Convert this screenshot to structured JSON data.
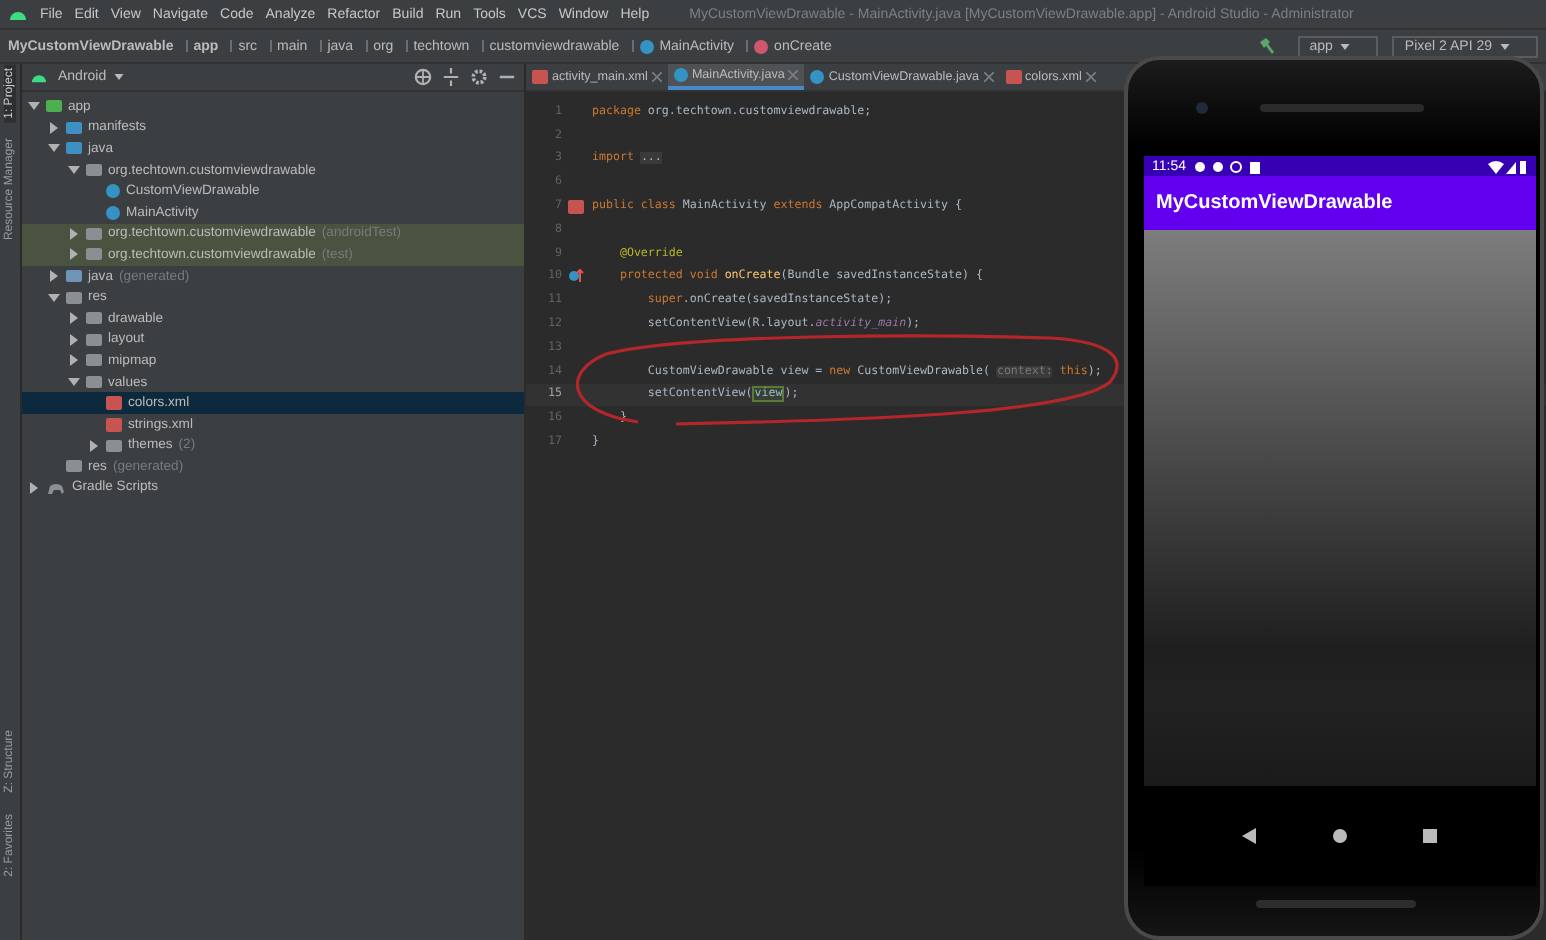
{
  "window": {
    "title": "MyCustomViewDrawable - MainActivity.java [MyCustomViewDrawable.app] - Android Studio - Administrator",
    "menu": [
      "File",
      "Edit",
      "View",
      "Navigate",
      "Code",
      "Analyze",
      "Refactor",
      "Build",
      "Run",
      "Tools",
      "VCS",
      "Window",
      "Help"
    ]
  },
  "breadcrumb": [
    {
      "label": "MyCustomViewDrawable",
      "kind": "project"
    },
    {
      "label": "app",
      "kind": "module"
    },
    {
      "label": "src",
      "kind": "folder"
    },
    {
      "label": "main",
      "kind": "folder"
    },
    {
      "label": "java",
      "kind": "folder"
    },
    {
      "label": "org",
      "kind": "folder"
    },
    {
      "label": "techtown",
      "kind": "folder"
    },
    {
      "label": "customviewdrawable",
      "kind": "folder"
    },
    {
      "label": "MainActivity",
      "kind": "class"
    },
    {
      "label": "onCreate",
      "kind": "method"
    }
  ],
  "toolbar": {
    "run_config": "app",
    "device": "Pixel 2 API 29"
  },
  "side_strip_top": [
    {
      "label": "1: Project",
      "selected": true
    },
    {
      "label": "Resource Manager",
      "selected": false
    }
  ],
  "side_strip_bottom": [
    {
      "label": "Z: Structure",
      "selected": false
    },
    {
      "label": "2: Favorites",
      "selected": false
    }
  ],
  "project_panel": {
    "view": "Android",
    "tree": [
      {
        "label": "app",
        "kind": "module",
        "expanded": true,
        "selected": false,
        "highlighted": false,
        "children": [
          {
            "label": "manifests",
            "kind": "folder",
            "expanded": false,
            "selected": false,
            "highlighted": false
          },
          {
            "label": "java",
            "kind": "folder",
            "expanded": true,
            "selected": false,
            "highlighted": false,
            "children": [
              {
                "label": "org.techtown.customviewdrawable",
                "kind": "package",
                "expanded": true,
                "selected": false,
                "highlighted": false,
                "children": [
                  {
                    "label": "CustomViewDrawable",
                    "kind": "class",
                    "selected": false,
                    "highlighted": false
                  },
                  {
                    "label": "MainActivity",
                    "kind": "class",
                    "selected": false,
                    "highlighted": false
                  }
                ]
              },
              {
                "label": "org.techtown.customviewdrawable",
                "suffix": "(androidTest)",
                "kind": "package",
                "expanded": false,
                "selected": false,
                "highlighted": true
              },
              {
                "label": "org.techtown.customviewdrawable",
                "suffix": "(test)",
                "kind": "package",
                "expanded": false,
                "selected": false,
                "highlighted": true
              }
            ]
          },
          {
            "label": "java",
            "suffix": "(generated)",
            "kind": "generated",
            "expanded": false,
            "selected": false,
            "highlighted": false
          },
          {
            "label": "res",
            "kind": "resfolder",
            "expanded": true,
            "selected": false,
            "highlighted": false,
            "children": [
              {
                "label": "drawable",
                "kind": "package",
                "expanded": false,
                "selected": false,
                "highlighted": false
              },
              {
                "label": "layout",
                "kind": "package",
                "expanded": false,
                "selected": false,
                "highlighted": false
              },
              {
                "label": "mipmap",
                "kind": "package",
                "expanded": false,
                "selected": false,
                "highlighted": false
              },
              {
                "label": "values",
                "kind": "package",
                "expanded": true,
                "selected": false,
                "highlighted": false,
                "children": [
                  {
                    "label": "colors.xml",
                    "kind": "xml",
                    "selected": true,
                    "highlighted": false
                  },
                  {
                    "label": "strings.xml",
                    "kind": "xml",
                    "selected": false,
                    "highlighted": false
                  },
                  {
                    "label": "themes",
                    "suffix": "(2)",
                    "kind": "package",
                    "expanded": false,
                    "selected": false,
                    "highlighted": false
                  }
                ]
              }
            ]
          },
          {
            "label": "res",
            "suffix": "(generated)",
            "kind": "resfolder",
            "selected": false,
            "highlighted": false
          }
        ]
      },
      {
        "label": "Gradle Scripts",
        "kind": "gradle",
        "expanded": false,
        "selected": false,
        "highlighted": false
      }
    ]
  },
  "editor": {
    "tabs": [
      {
        "label": "activity_main.xml",
        "kind": "xml",
        "selected": false
      },
      {
        "label": "MainActivity.java",
        "kind": "class",
        "selected": true
      },
      {
        "label": "CustomViewDrawable.java",
        "kind": "class",
        "selected": false
      },
      {
        "label": "colors.xml",
        "kind": "xml",
        "selected": false
      }
    ],
    "lines": [
      {
        "number": "1",
        "kind": "plain",
        "current": false,
        "tokens": [
          {
            "kind": "kw",
            "text": "package "
          },
          {
            "kind": "plain",
            "text": "org.techtown.customviewdrawable;"
          }
        ]
      },
      {
        "number": "2",
        "kind": "plain",
        "current": false
      },
      {
        "number": "3",
        "kind": "plain",
        "current": false,
        "tokens": [
          {
            "kind": "kw",
            "text": "import "
          },
          {
            "kind": "fold",
            "text": "..."
          }
        ]
      },
      {
        "number": "6",
        "kind": "plain",
        "current": false
      },
      {
        "number": "7",
        "kind": "layout_link",
        "current": false,
        "tokens": [
          {
            "kind": "kw",
            "text": "public class "
          },
          {
            "kind": "plain",
            "text": "MainActivity "
          },
          {
            "kind": "kw",
            "text": "extends "
          },
          {
            "kind": "plain",
            "text": "AppCompatActivity {"
          }
        ]
      },
      {
        "number": "8",
        "kind": "plain",
        "current": false
      },
      {
        "number": "9",
        "kind": "plain",
        "current": false,
        "tokens": [
          {
            "kind": "annotation",
            "text": "    @Override"
          }
        ]
      },
      {
        "number": "10",
        "kind": "override",
        "current": false,
        "tokens": [
          {
            "kind": "kw",
            "text": "    protected void "
          },
          {
            "kind": "method",
            "text": "onCreate"
          },
          {
            "kind": "plain",
            "text": "(Bundle savedInstanceState) {"
          }
        ]
      },
      {
        "number": "11",
        "kind": "plain",
        "current": false,
        "tokens": [
          {
            "kind": "kw",
            "text": "        super"
          },
          {
            "kind": "plain",
            "text": ".onCreate(savedInstanceState);"
          }
        ]
      },
      {
        "number": "12",
        "kind": "plain",
        "current": false,
        "tokens": [
          {
            "kind": "plain",
            "text": "        setContentView(R.layout."
          },
          {
            "kind": "field",
            "text": "activity_main"
          },
          {
            "kind": "plain",
            "text": ");"
          }
        ]
      },
      {
        "number": "13",
        "kind": "plain",
        "current": false
      },
      {
        "number": "14",
        "kind": "plain",
        "current": false,
        "tokens": [
          {
            "kind": "plain",
            "text": "        CustomViewDrawable view = "
          },
          {
            "kind": "kw",
            "text": "new "
          },
          {
            "kind": "plain",
            "text": "CustomViewDrawable( "
          },
          {
            "kind": "hint",
            "text": "context:"
          },
          {
            "kind": "kw",
            "text": " this"
          },
          {
            "kind": "plain",
            "text": ");"
          }
        ]
      },
      {
        "number": "15",
        "kind": "plain",
        "current": true,
        "tokens": [
          {
            "kind": "plain",
            "text": "        setContentView("
          },
          {
            "kind": "match",
            "text": "view"
          },
          {
            "kind": "plain",
            "text": ");"
          }
        ]
      },
      {
        "number": "16",
        "kind": "plain",
        "current": false,
        "tokens": [
          {
            "kind": "plain",
            "text": "    }"
          }
        ]
      },
      {
        "number": "17",
        "kind": "plain",
        "current": false,
        "tokens": [
          {
            "kind": "plain",
            "text": "}"
          }
        ]
      }
    ]
  },
  "emulator": {
    "status_time": "11:54",
    "app_title": "MyCustomViewDrawable"
  }
}
